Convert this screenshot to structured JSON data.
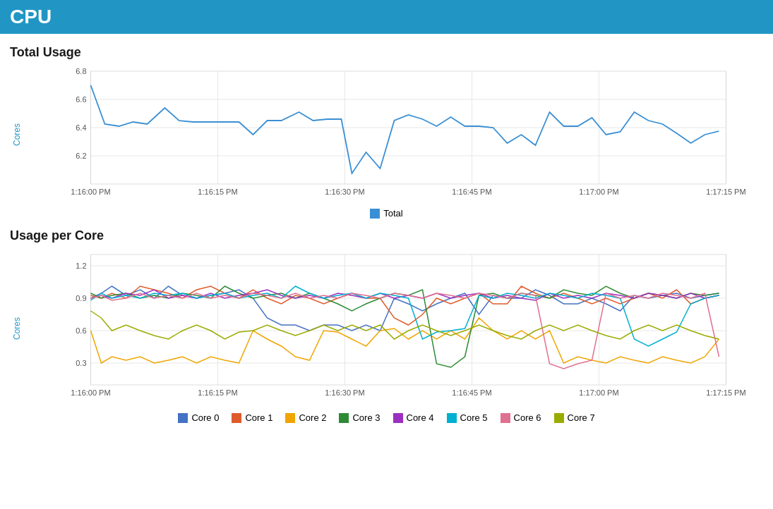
{
  "header": {
    "title": "CPU",
    "bg_color": "#2196c4"
  },
  "total_usage": {
    "section_title": "Total Usage",
    "y_label": "Cores",
    "y_min": 6.1,
    "y_max": 6.9,
    "y_ticks": [
      6.2,
      6.4,
      6.6,
      6.8
    ],
    "x_labels": [
      "1:16:00 PM",
      "1:16:15 PM",
      "1:16:30 PM",
      "1:16:45 PM",
      "1:17:00 PM",
      "1:17:15 PM"
    ],
    "legend": [
      {
        "label": "Total",
        "color": "#3a8fd4"
      }
    ]
  },
  "per_core": {
    "section_title": "Usage per Core",
    "y_label": "Cores",
    "y_min": 0.1,
    "y_max": 1.3,
    "y_ticks": [
      0.3,
      0.6,
      0.9,
      1.2
    ],
    "x_labels": [
      "1:16:00 PM",
      "1:16:15 PM",
      "1:16:30 PM",
      "1:16:45 PM",
      "1:17:00 PM",
      "1:17:15 PM"
    ],
    "legend": [
      {
        "label": "Core 0",
        "color": "#4472c4"
      },
      {
        "label": "Core 1",
        "color": "#e05b2b"
      },
      {
        "label": "Core 2",
        "color": "#f0a500"
      },
      {
        "label": "Core 3",
        "color": "#2e8b35"
      },
      {
        "label": "Core 4",
        "color": "#9b30c0"
      },
      {
        "label": "Core 5",
        "color": "#00b0d0"
      },
      {
        "label": "Core 6",
        "color": "#e07090"
      },
      {
        "label": "Core 7",
        "color": "#9aab00"
      }
    ]
  }
}
